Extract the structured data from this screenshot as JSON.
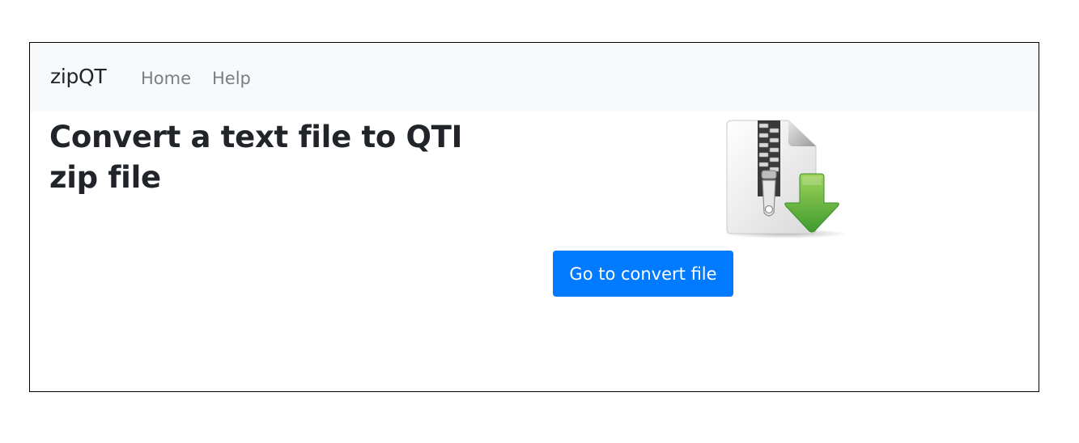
{
  "navbar": {
    "brand": "zipQT",
    "links": [
      {
        "label": "Home"
      },
      {
        "label": "Help"
      }
    ]
  },
  "main": {
    "title": "Convert a text file to QTI zip file",
    "image_icon": "zip-file-download-icon",
    "button_label": "Go to convert file"
  },
  "colors": {
    "navbar_bg": "#f8f9fa",
    "button_primary": "#007bff",
    "text_dark": "#212529",
    "nav_link": "#7b7f83",
    "arrow_green": "#6cbe45"
  }
}
